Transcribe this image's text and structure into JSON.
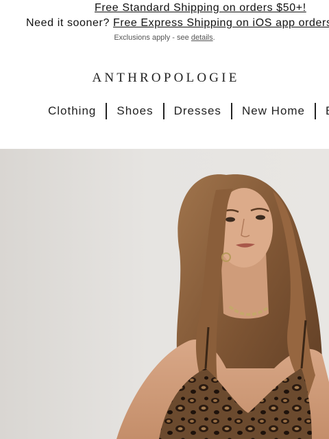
{
  "promo": {
    "line1_link": "Free Standard Shipping on orders $50+!",
    "line2_prefix": "Need it sooner?",
    "line2_link": "Free Express Shipping on iOS app orders",
    "exclusions_prefix": "Exclusions apply - see",
    "exclusions_link": "details",
    "exclusions_suffix": "."
  },
  "brand": {
    "logo": "ANTHROPOLOGIE"
  },
  "nav": {
    "items": [
      "Clothing",
      "Shoes",
      "Dresses",
      "New Home",
      "B"
    ]
  },
  "hero": {
    "image": "woman-leopard-print-top-photo"
  }
}
